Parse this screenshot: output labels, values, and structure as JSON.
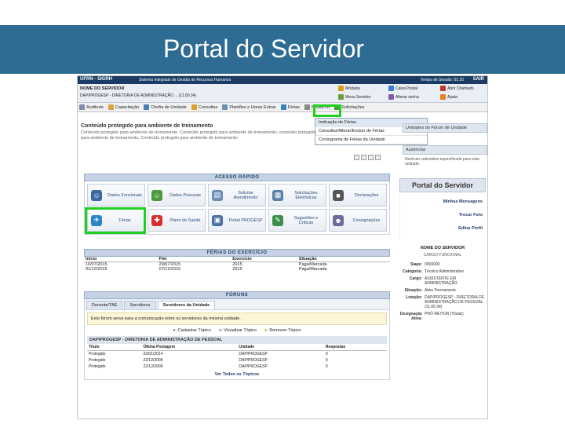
{
  "slide": {
    "title": "Portal do Servidor"
  },
  "app": {
    "system_short": "UFRN - SIGRH",
    "system_name": "Sistema Integrado de Gestão de Recursos Humanos",
    "session_time": "Tempo de Sessão: 01:25",
    "exit_label": "SAIR",
    "user_name": "NOME DO SERVIDOR",
    "user_unit": "DAP/PROGESP - DIRETORIA DE ADMINISTRAÇÃO ... (11.00.34)",
    "quick_links": [
      {
        "label": "Módulos",
        "color": "#d4a017"
      },
      {
        "label": "Caixa Postal",
        "color": "#3a7bd5"
      },
      {
        "label": "Abrir Chamado",
        "color": "#c0392b"
      },
      {
        "label": "Menu Servidor",
        "color": "#6a9e3b"
      },
      {
        "label": "Alterar senha",
        "color": "#7b5ea7"
      },
      {
        "label": "Ajuda",
        "color": "#e67e22"
      }
    ]
  },
  "menu": {
    "items": [
      "Auditoria",
      "Capacitação",
      "Chefia de Unidade",
      "Consultas",
      "Plantões e Horas Extras",
      "Férias",
      "Nessa no",
      "Solicitações"
    ]
  },
  "dropdown": {
    "items": [
      "Indicação de Férias",
      "Consultar/Alterar/Excluir de Férias",
      "Cronograma de Férias da Unidade"
    ]
  },
  "notice": {
    "title": "Conteúdo protegido para ambiente de treinamento",
    "text": "Conteúdo protegido para ambiente de treinamento. Conteúdo protegido para ambiente de treinamento, conteúdo protegido para ambiente de treinamento. Conteúdo protegido para ambiente de treinamento."
  },
  "right_panel": {
    "units_head": "Unidades do Fórum de Unidade",
    "absences_head": "Ausências",
    "absences_text": "Nenhum calendário especificado para esta unidade."
  },
  "acesso": {
    "header": "ACESSO RÁPIDO",
    "tiles": [
      {
        "label": "Dados Funcionais",
        "icon": "user-icon",
        "color": "#3b6aa0"
      },
      {
        "label": "Dados Pessoais",
        "icon": "person-icon",
        "color": "#4a9a3a"
      },
      {
        "label": "Solicitar Atendimento",
        "icon": "document-icon",
        "color": "#6b8fb8"
      },
      {
        "label": "Solicitações Eletrônicas",
        "icon": "form-icon",
        "color": "#5a7fa8"
      },
      {
        "label": "Declarações",
        "icon": "briefcase-icon",
        "color": "#555555"
      },
      {
        "label": "Férias",
        "icon": "airplane-icon",
        "color": "#2e86c1"
      },
      {
        "label": "Plano de Saúde",
        "icon": "health-cross-icon",
        "color": "#d63031"
      },
      {
        "label": "Portal PROGESP",
        "icon": "portal-icon",
        "color": "#4a6fa5"
      },
      {
        "label": "Sugestões e Críticas",
        "icon": "suggestion-icon",
        "color": "#3a8f4a"
      },
      {
        "label": "Consignações",
        "icon": "people-icon",
        "color": "#6b6b9a"
      }
    ]
  },
  "ferias": {
    "header": "FÉRIAS DO EXERCÍCIO",
    "columns": [
      "Início",
      "Fim",
      "Exercício",
      "Situação"
    ],
    "rows": [
      [
        "10/07/2015",
        "29/07/2015",
        "2015",
        "Paga/Marcada"
      ],
      [
        "01/12/2015",
        "07/12/2015",
        "2015",
        "Paga/Marcada"
      ]
    ]
  },
  "forum": {
    "header": "FÓRUNS",
    "tabs": [
      "Docente/TAE",
      "Servidores",
      "Servidores da Unidade"
    ],
    "description": "Este fórum serve para a comunicação entre os servidores da mesma unidade.",
    "actions": [
      ": Cadastrar Tópico",
      ": Visualizar Tópico",
      ": Remover Tópico"
    ],
    "unit": "DAP/PROGESP - DIRETORIA DE ADMINISTRAÇÃO DE PESSOAL",
    "columns": [
      "Título",
      "Última Postagem",
      "Unidade",
      "Respostas"
    ],
    "rows": [
      [
        "Protegido",
        "22/01/2014",
        "DAP/PROGESP",
        "0"
      ],
      [
        "Protegido",
        "22/12/2009",
        "DAP/PROGESP",
        "0"
      ],
      [
        "Protegido",
        "22/12/2009",
        "DAP/PROGESP",
        "0"
      ]
    ],
    "see_all": "Ver Todos os Tópicos"
  },
  "profile": {
    "title": "Portal do Servidor",
    "links": [
      "Minhas Mensagens",
      "Trocar Foto",
      "Editar Perfil"
    ],
    "name": "NOME DO SERVIDOR",
    "role": "CARGO FUNCIONAL",
    "fields": [
      {
        "k": "Siape:",
        "v": "0000000"
      },
      {
        "k": "Categoria:",
        "v": "Técnico Administrativo"
      },
      {
        "k": "Cargo:",
        "v": "ASSISTENTE EM ADMINISTRAÇÃO"
      },
      {
        "k": "Situação:",
        "v": "Ativo Permanente"
      },
      {
        "k": "Lotação:",
        "v": "DAP/PROGESP - DIRETORIA DE ADMINISTRAÇÃO DE PESSOAL (11.00.34)"
      },
      {
        "k": "Designação Ativa:",
        "v": "PRÓ-REITOR (Titular)"
      }
    ]
  }
}
